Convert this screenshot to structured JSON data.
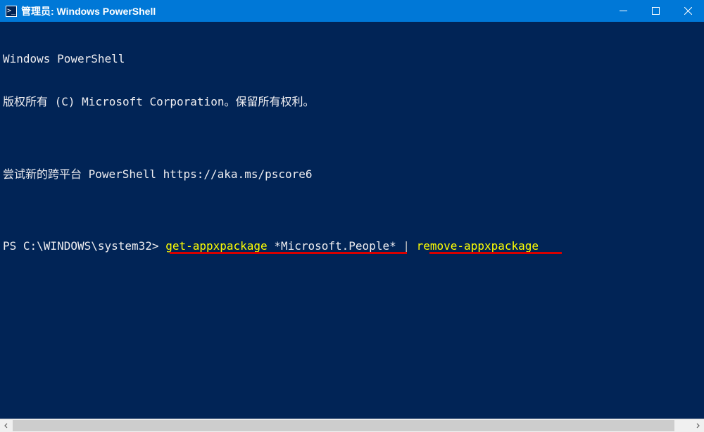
{
  "titlebar": {
    "icon_glyph": ">_",
    "title": "管理员: Windows PowerShell"
  },
  "terminal": {
    "line1": "Windows PowerShell",
    "line2": "版权所有 (C) Microsoft Corporation。保留所有权利。",
    "line3": "",
    "line4": "尝试新的跨平台 PowerShell https://aka.ms/pscore6",
    "line5": "",
    "prompt": "PS C:\\WINDOWS\\system32> ",
    "cmd_part1": "get-appxpackage",
    "cmd_part2": " *Microsoft.People* ",
    "cmd_pipe": "|",
    "cmd_part3": " ",
    "cmd_part4": "remove-appxpackage"
  }
}
